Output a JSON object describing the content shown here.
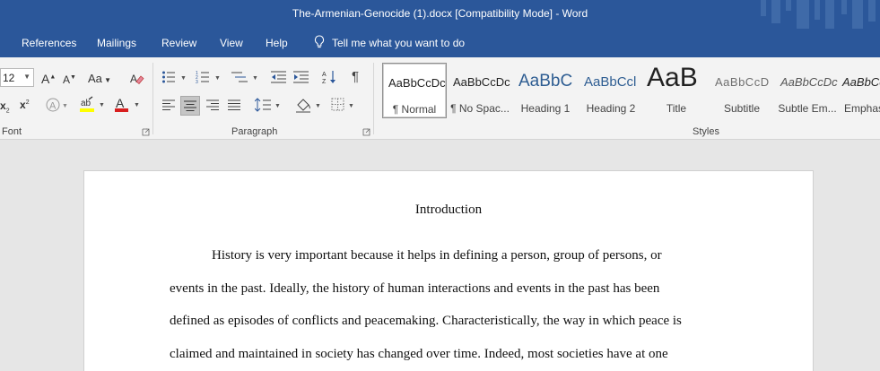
{
  "window": {
    "title": "The-Armenian-Genocide (1).docx  [Compatibility Mode]  -  Word"
  },
  "tabs": {
    "references": "References",
    "mailings": "Mailings",
    "review": "Review",
    "view": "View",
    "help": "Help",
    "tell_me": "Tell me what you want to do"
  },
  "ribbon": {
    "font": {
      "size": "12",
      "grow_label": "A",
      "shrink_label": "A",
      "change_case_label": "Aa",
      "subscript_label": "x",
      "superscript_label": "x",
      "group_label": "Font"
    },
    "paragraph": {
      "group_label": "Paragraph",
      "active_alignment": "justify"
    },
    "styles": {
      "group_label": "Styles",
      "items": [
        {
          "sample": "AaBbCcDc",
          "label": "¶ Normal"
        },
        {
          "sample": "AaBbCcDc",
          "label": "¶ No Spac..."
        },
        {
          "sample": "AaBbC",
          "label": "Heading 1"
        },
        {
          "sample": "AaBbCcl",
          "label": "Heading 2"
        },
        {
          "sample": "AaB",
          "label": "Title"
        },
        {
          "sample": "AaBbCcD",
          "label": "Subtitle"
        },
        {
          "sample": "AaBbCcDc",
          "label": "Subtle Em..."
        },
        {
          "sample": "AaBbCc",
          "label": "Emphas"
        }
      ]
    }
  },
  "colors": {
    "word_blue": "#2b579a",
    "highlight_yellow": "#ffff00",
    "font_red": "#d81e1e",
    "heading_blue": "#2e5d92"
  },
  "document": {
    "heading": "Introduction",
    "lines": [
      "History is very important because it helps in defining a person, group of persons, or",
      "events in the past. Ideally, the history of human interactions and events in the past has been",
      "defined as episodes of conflicts and peacemaking. Characteristically, the way in which peace is",
      "claimed and maintained in society has changed over time. Indeed, most societies have at one"
    ]
  }
}
